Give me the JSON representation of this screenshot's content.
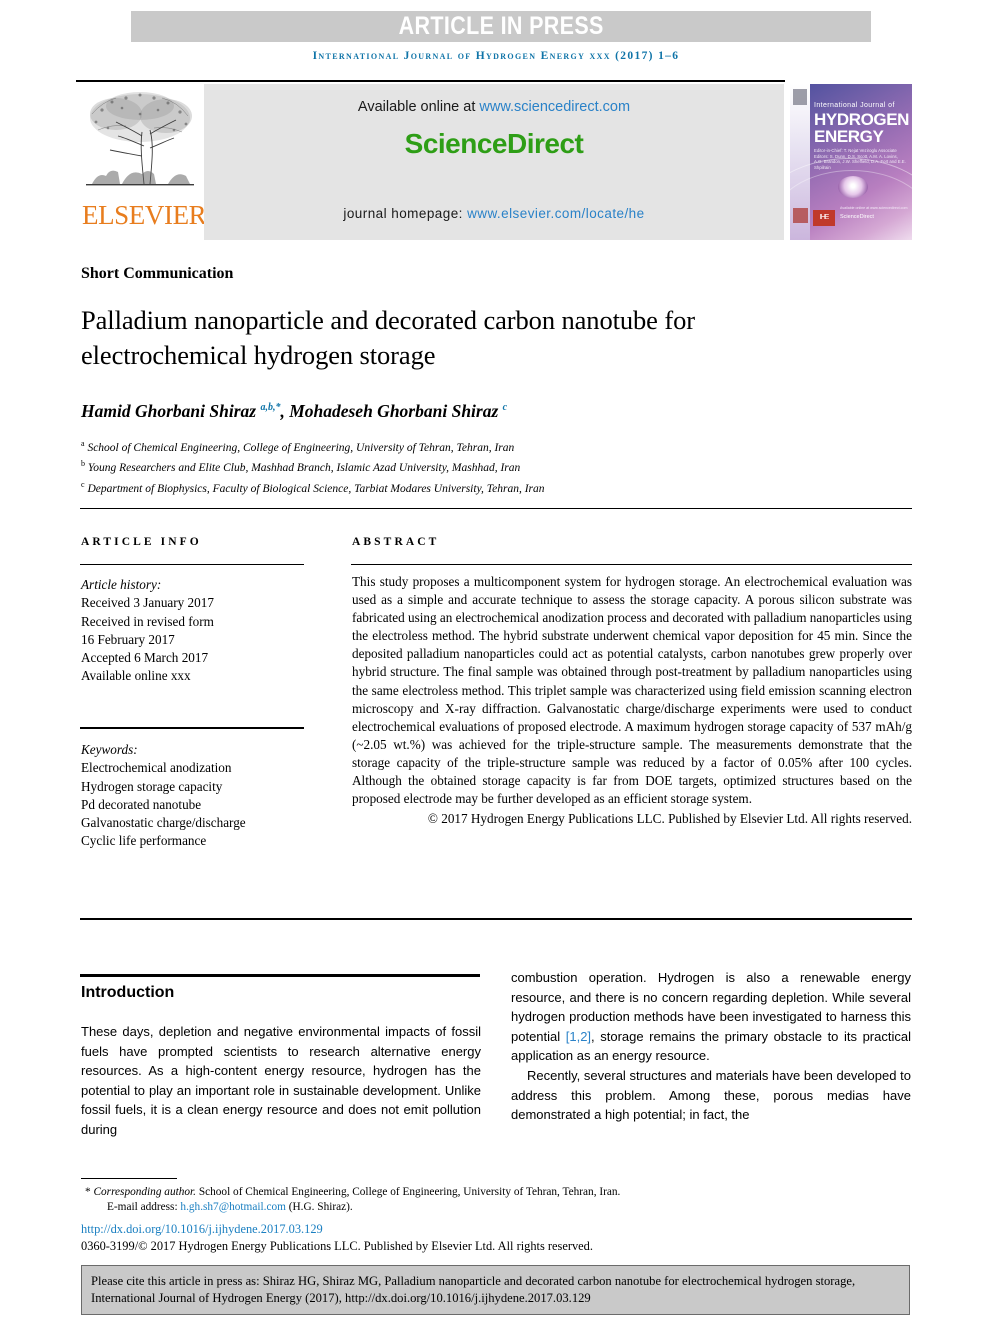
{
  "banner": {
    "article_in_press": "ARTICLE IN PRESS",
    "running_head": "International Journal of Hydrogen Energy xxx (2017) 1–6"
  },
  "masthead": {
    "publisher_name": "ELSEVIER",
    "available_online_prefix": "Available online at ",
    "sciencedirect_url": "www.sciencedirect.com",
    "sciencedirect_logo": "ScienceDirect",
    "journal_homepage_label": "journal homepage: ",
    "journal_homepage_url": "www.elsevier.com/locate/he"
  },
  "cover": {
    "line_international": "International Journal of",
    "line_hydrogen": "HYDROGEN",
    "line_energy": "ENERGY",
    "editors": "Editor-in-Chief: T. Nejat Veziroglu   Associate Editors: S. Dunn, D.S. Scott, A.M. A. Lovins, A.G. Brandon, J.W. Sheffield, D.A. Fort and E.E. Shpilrain",
    "badge_ihe": "IHE",
    "sciencedirect_small": "ScienceDirect",
    "sciencedirect_above": "Available online at www.sciencedirect.com"
  },
  "article": {
    "type": "Short Communication",
    "title": "Palladium nanoparticle and decorated carbon nanotube for electrochemical hydrogen storage",
    "authors_line_1": "Hamid Ghorbani Shiraz ",
    "authors_sup_1": "a,b,*",
    "authors_line_2": ", Mohadeseh Ghorbani Shiraz ",
    "authors_sup_2": "c",
    "affiliations": [
      {
        "marker": "a",
        "text": " School of Chemical Engineering, College of Engineering, University of Tehran, Tehran, Iran"
      },
      {
        "marker": "b",
        "text": " Young Researchers and Elite Club, Mashhad Branch, Islamic Azad University, Mashhad, Iran"
      },
      {
        "marker": "c",
        "text": " Department of Biophysics, Faculty of Biological Science, Tarbiat Modares University, Tehran, Iran"
      }
    ]
  },
  "article_info": {
    "header": "ARTICLE INFO",
    "history_label": "Article history:",
    "history_lines": [
      "Received 3 January 2017",
      "Received in revised form",
      "16 February 2017",
      "Accepted 6 March 2017",
      "Available online xxx"
    ],
    "keywords_label": "Keywords:",
    "keywords": [
      "Electrochemical anodization",
      "Hydrogen storage capacity",
      "Pd decorated nanotube",
      "Galvanostatic charge/discharge",
      "Cyclic life performance"
    ]
  },
  "abstract": {
    "header": "ABSTRACT",
    "body": "This study proposes a multicomponent system for hydrogen storage. An electrochemical evaluation was used as a simple and accurate technique to assess the storage capacity. A porous silicon substrate was fabricated using an electrochemical anodization process and decorated with palladium nanoparticles using the electroless method. The hybrid substrate underwent chemical vapor deposition for 45 min. Since the deposited palladium nanoparticles could act as potential catalysts, carbon nanotubes grew properly over hybrid structure. The final sample was obtained through post-treatment by palladium nanoparticles using the same electroless method. This triplet sample was characterized using field emission scanning electron microscopy and X-ray diffraction. Galvanostatic charge/discharge experiments were used to conduct electrochemical evaluations of proposed electrode. A maximum hydrogen storage capacity of 537 mAh/g (~2.05 wt.%) was achieved for the triple-structure sample. The measurements demonstrate that the storage capacity of the triple-structure sample was reduced by a factor of 0.05% after 100 cycles. Although the obtained storage capacity is far from DOE targets, optimized structures based on the proposed electrode may be further developed as an efficient storage system.",
    "copyright": "© 2017 Hydrogen Energy Publications LLC. Published by Elsevier Ltd. All rights reserved."
  },
  "introduction": {
    "heading": "Introduction",
    "left_paragraph": "These days, depletion and negative environmental impacts of fossil fuels have prompted scientists to research alternative energy resources. As a high-content energy resource, hydrogen has the potential to play an important role in sustainable development. Unlike fossil fuels, it is a clean energy resource and does not emit pollution during",
    "right_paragraph_1_a": "combustion operation. Hydrogen is also a renewable energy resource, and there is no concern regarding depletion. While several hydrogen production methods have been investigated to harness this potential ",
    "right_paragraph_1_ref": "[1,2]",
    "right_paragraph_1_b": ", storage remains the primary obstacle to its practical application as an energy resource.",
    "right_paragraph_2": "Recently, several structures and materials have been developed to address this problem. Among these, porous medias have demonstrated a high potential; in fact, the"
  },
  "footer": {
    "corresponding_marker": "*",
    "corresponding_label": "Corresponding author.",
    "corresponding_text": " School of Chemical Engineering, College of Engineering, University of Tehran, Tehran, Iran.",
    "email_label": "E-mail address: ",
    "email_address": "h.gh.sh7@hotmail.com",
    "email_suffix": " (H.G. Shiraz).",
    "doi_url": "http://dx.doi.org/10.1016/j.ijhydene.2017.03.129",
    "issn_line": "0360-3199/© 2017 Hydrogen Energy Publications LLC. Published by Elsevier Ltd. All rights reserved.",
    "cite_notice": "Please cite this article in press as: Shiraz HG, Shiraz MG, Palladium nanoparticle and decorated carbon nanotube for electrochemical hydrogen storage, International Journal of Hydrogen Energy (2017), http://dx.doi.org/10.1016/j.ijhydene.2017.03.129"
  },
  "colors": {
    "banner_gray": "#c9c9c9",
    "journal_blue": "#0f74a8",
    "link_blue": "#2a82c8",
    "sciencedirect_green": "#2e9e16",
    "elsevier_orange": "#e87d1e"
  }
}
